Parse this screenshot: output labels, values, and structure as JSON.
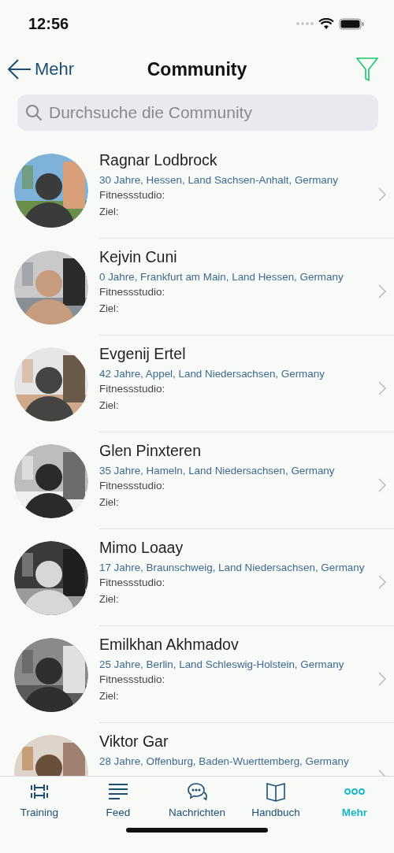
{
  "status_bar": {
    "time": "12:56"
  },
  "nav": {
    "back_label": "Mehr",
    "title": "Community"
  },
  "search": {
    "placeholder": "Durchsuche die Community"
  },
  "members": [
    {
      "name": "Ragnar Lodbrock",
      "location": "30 Jahre, Hessen, Land Sachsen-Anhalt, Germany",
      "gym_label": "Fitnessstudio:",
      "goal_label": "Ziel:"
    },
    {
      "name": "Kejvin Cuni",
      "location": "0 Jahre, Frankfurt am Main, Land Hessen, Germany",
      "gym_label": "Fitnessstudio:",
      "goal_label": "Ziel:"
    },
    {
      "name": "Evgenij Ertel",
      "location": "42 Jahre, Appel, Land Niedersachsen, Germany",
      "gym_label": "Fitnessstudio:",
      "goal_label": "Ziel:"
    },
    {
      "name": "Glen Pinxteren",
      "location": "35 Jahre, Hameln, Land Niedersachsen, Germany",
      "gym_label": "Fitnessstudio:",
      "goal_label": "Ziel:"
    },
    {
      "name": "Mimo Loaay",
      "location": "17 Jahre, Braunschweig, Land Niedersachsen, Germany",
      "gym_label": "Fitnessstudio:",
      "goal_label": "Ziel:"
    },
    {
      "name": "Emilkhan Akhmadov",
      "location": "25 Jahre, Berlin, Land Schleswig-Holstein, Germany",
      "gym_label": "Fitnessstudio:",
      "goal_label": "Ziel:"
    },
    {
      "name": "Viktor Gar",
      "location": "28 Jahre, Offenburg, Baden-Wuerttemberg, Germany"
    }
  ],
  "tab_bar": [
    {
      "label": "Training",
      "kind": "dumbbells",
      "selected": false
    },
    {
      "label": "Feed",
      "kind": "lines",
      "selected": false
    },
    {
      "label": "Nachrichten",
      "kind": "chat",
      "selected": false
    },
    {
      "label": "Handbuch",
      "kind": "book",
      "selected": false
    },
    {
      "label": "Mehr",
      "kind": "dots",
      "selected": true
    }
  ]
}
